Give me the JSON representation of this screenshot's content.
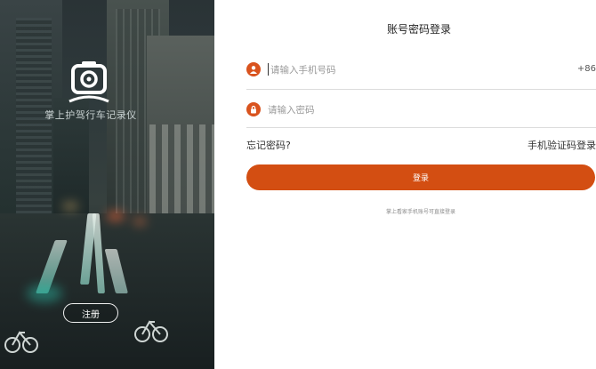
{
  "hero": {
    "app_name": "掌上护驾行车记录仪",
    "register_label": "注册"
  },
  "form": {
    "title": "账号密码登录",
    "phone_placeholder": "请输入手机号码",
    "country_code": "+86",
    "password_placeholder": "请输入密码",
    "forgot_label": "忘记密码?",
    "sms_login_label": "手机验证码登录",
    "login_label": "登录",
    "hint": "掌上看家手机账号可直接登录"
  },
  "colors": {
    "accent": "#d34e12",
    "icon": "#d9531e"
  },
  "icons": {
    "logo": "camera-car-icon",
    "phone": "user-icon",
    "password": "lock-icon"
  }
}
